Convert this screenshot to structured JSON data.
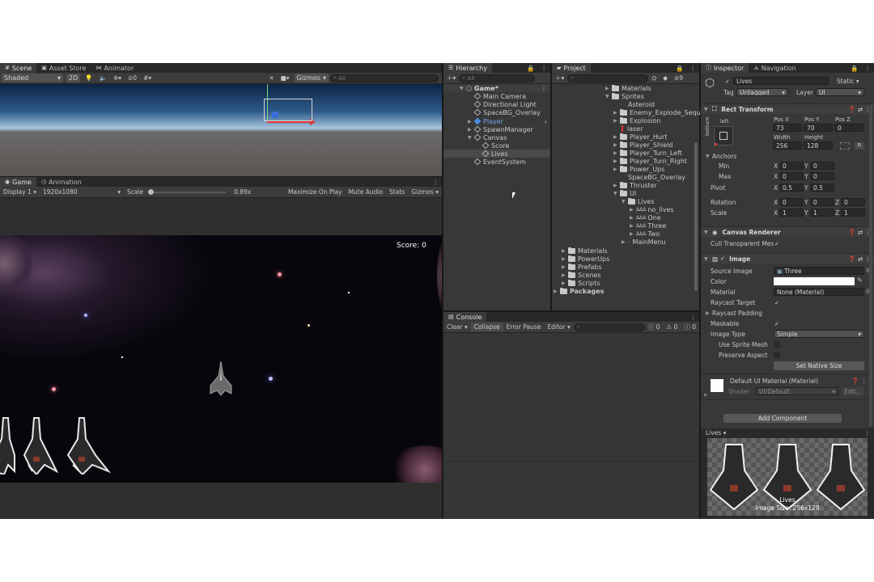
{
  "scene_panel": {
    "tabs": [
      {
        "label": "Scene"
      },
      {
        "label": "Asset Store"
      },
      {
        "label": "Animator"
      }
    ],
    "shading": "Shaded",
    "mode_2d": "2D",
    "hidden_count": "0",
    "gizmos": "Gizmos",
    "search_placeholder": "All"
  },
  "game_panel": {
    "tabs": [
      {
        "label": "Game"
      },
      {
        "label": "Animation"
      }
    ],
    "display": "Display 1",
    "resolution": "1920x1080",
    "scale_label": "Scale",
    "scale_value": "0.89x",
    "maximize": "Maximize On Play",
    "mute": "Mute Audio",
    "stats": "Stats",
    "gizmos": "Gizmos",
    "score_text": "Score: 0"
  },
  "hierarchy": {
    "title": "Hierarchy",
    "search_placeholder": "All",
    "items": [
      {
        "label": "Game*"
      },
      {
        "label": "Main Camera"
      },
      {
        "label": "Directional Light"
      },
      {
        "label": "SpaceBG_Overlay"
      },
      {
        "label": "Player"
      },
      {
        "label": "SpawnManager"
      },
      {
        "label": "Canvas"
      },
      {
        "label": "Score"
      },
      {
        "label": "Lives"
      },
      {
        "label": "EventSystem"
      }
    ]
  },
  "project": {
    "title": "Project",
    "hidden_count": "9",
    "items": [
      {
        "label": "Materials"
      },
      {
        "label": "Sprites"
      },
      {
        "label": "Asteroid"
      },
      {
        "label": "Enemy_Explode_Seque"
      },
      {
        "label": "Explosion"
      },
      {
        "label": "laser"
      },
      {
        "label": "Player_Hurt"
      },
      {
        "label": "Player_Shield"
      },
      {
        "label": "Player_Turn_Left"
      },
      {
        "label": "Player_Turn_Right"
      },
      {
        "label": "Power_Ups"
      },
      {
        "label": "SpaceBG_Overlay"
      },
      {
        "label": "Thruster"
      },
      {
        "label": "UI"
      },
      {
        "label": "Lives"
      },
      {
        "label": "no_lives"
      },
      {
        "label": "One"
      },
      {
        "label": "Three"
      },
      {
        "label": "Two"
      },
      {
        "label": "MainMenu"
      },
      {
        "label": "Materials"
      },
      {
        "label": "PowerUps"
      },
      {
        "label": "Prefabs"
      },
      {
        "label": "Scenes"
      },
      {
        "label": "Scripts"
      },
      {
        "label": "Packages"
      }
    ]
  },
  "console": {
    "title": "Console",
    "clear": "Clear",
    "collapse": "Collapse",
    "error_pause": "Error Pause",
    "editor": "Editor",
    "count_info": "0",
    "count_warn": "0",
    "count_error": "0"
  },
  "inspector": {
    "tabs": [
      {
        "label": "Inspector"
      },
      {
        "label": "Navigation"
      }
    ],
    "object_name": "Lives",
    "static_label": "Static",
    "tag_label": "Tag",
    "tag_value": "Untagged",
    "layer_label": "Layer",
    "layer_value": "UI",
    "rect_transform": "Rect Transform",
    "anchor_left": "left",
    "anchor_bottom": "bottom",
    "pos_x_label": "Pos X",
    "pos_y_label": "Pos Y",
    "pos_z_label": "Pos Z",
    "pos_x": "73",
    "pos_y": "70",
    "pos_z": "0",
    "width_label": "Width",
    "height_label": "Height",
    "width": "256",
    "height": "128",
    "r_label": "R",
    "anchors_label": "Anchors",
    "min_label": "Min",
    "max_label": "Max",
    "x_label": "X",
    "y_label": "Y",
    "z_label": "Z",
    "min_x": "0",
    "min_y": "0",
    "max_x": "0",
    "max_y": "0",
    "pivot_label": "Pivot",
    "pivot_x": "0.5",
    "pivot_y": "0.5",
    "rotation_label": "Rotation",
    "rot_x": "0",
    "rot_y": "0",
    "rot_z": "0",
    "scale_label": "Scale",
    "scale_x": "1",
    "scale_y": "1",
    "scale_z": "1",
    "canvas_renderer": "Canvas Renderer",
    "cull_label": "Cull Transparent Mes",
    "image": "Image",
    "source_image_label": "Source Image",
    "source_image": "Three",
    "color_label": "Color",
    "material_label": "Material",
    "material_value": "None (Material)",
    "raycast_target": "Raycast Target",
    "raycast_padding": "Raycast Padding",
    "maskable": "Maskable",
    "image_type_label": "Image Type",
    "image_type": "Simple",
    "use_sprite_mesh": "Use Sprite Mesh",
    "preserve_aspect": "Preserve Aspect",
    "set_native_size": "Set Native Size",
    "default_material": "Default UI Material (Material)",
    "shader_label": "Shader",
    "shader_value": "UI/Default",
    "edit_label": "Edit...",
    "add_component": "Add Component",
    "preview_title": "Lives",
    "preview_name": "Lives",
    "preview_size": "Image Size: 256x128"
  }
}
